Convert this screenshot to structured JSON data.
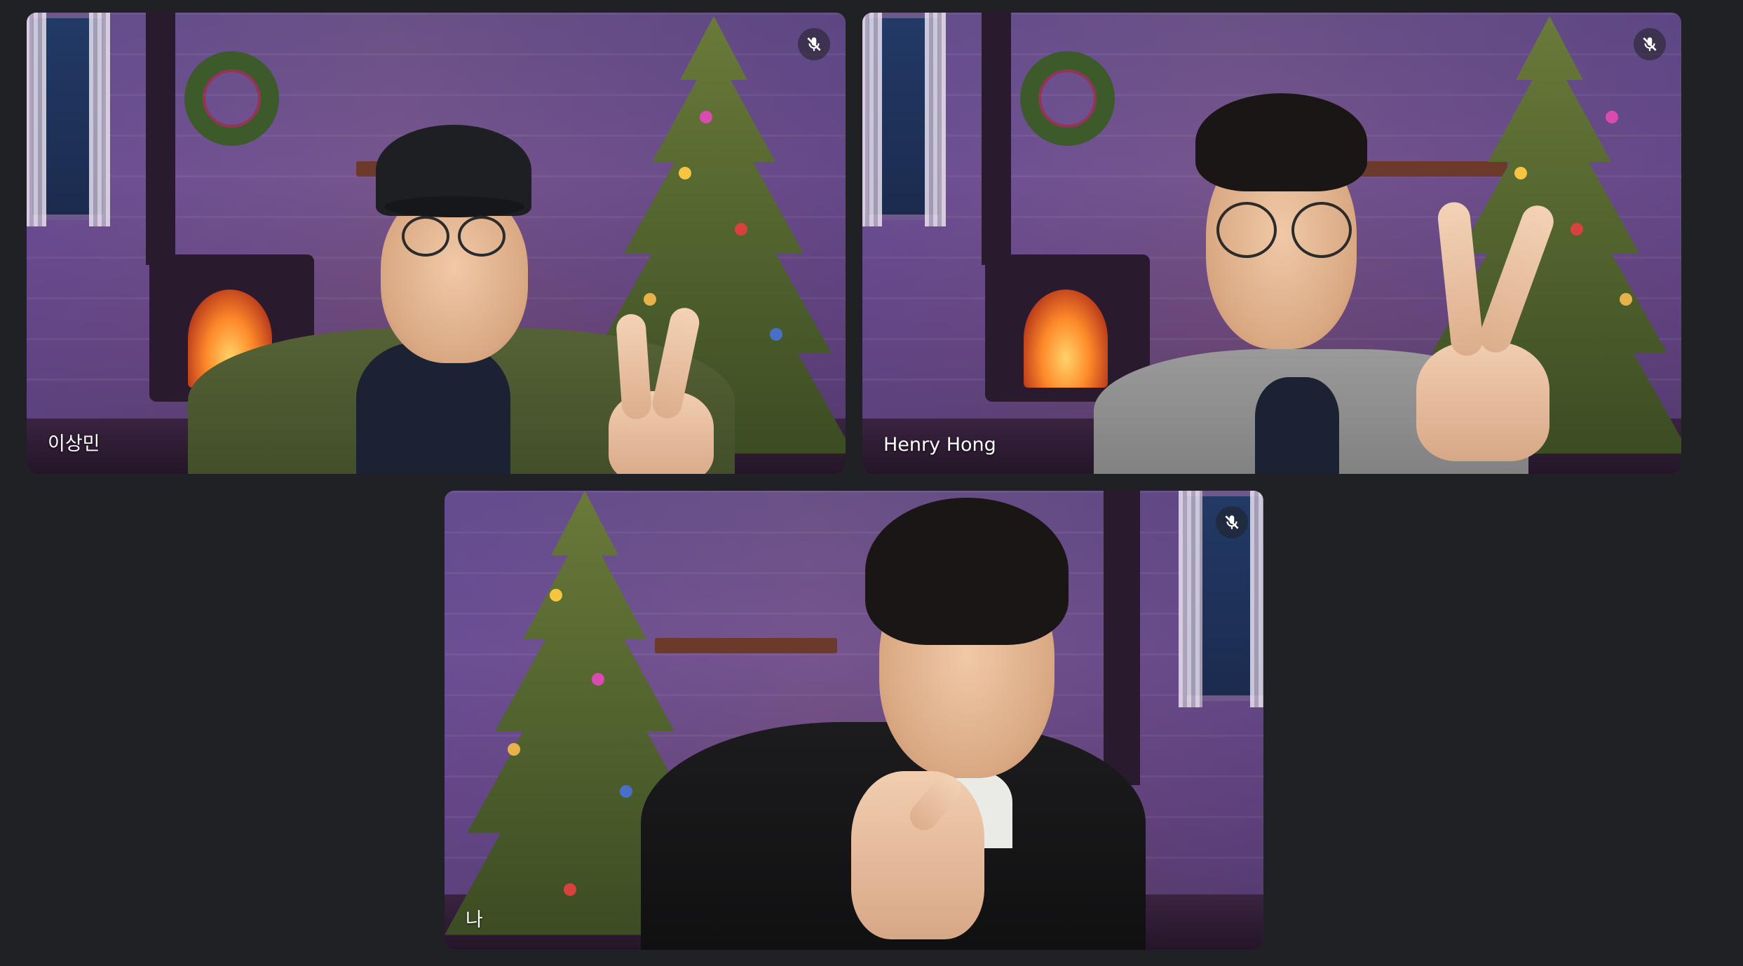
{
  "participants": [
    {
      "name": "이상민",
      "muted": true,
      "mute_icon": "mic-off-icon"
    },
    {
      "name": "Henry Hong",
      "muted": true,
      "mute_icon": "mic-off-icon"
    },
    {
      "name": "나",
      "muted": true,
      "mute_icon": "mic-off-icon"
    }
  ],
  "background_theme": "christmas-cabin",
  "colors": {
    "page_bg": "#202124",
    "label_text": "#ffffff"
  }
}
